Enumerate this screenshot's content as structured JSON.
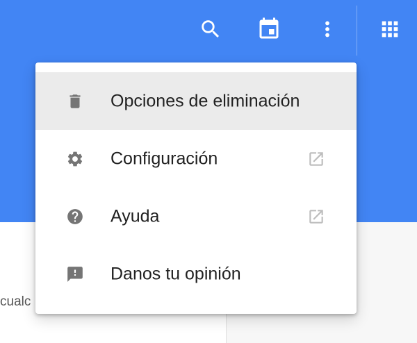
{
  "appbar": {
    "color": "#4285f4",
    "icons": {
      "search": "search-icon",
      "calendar": "calendar-icon",
      "more": "more-vert-icon",
      "apps": "apps-grid-icon"
    }
  },
  "background_text": "cualc",
  "menu": {
    "items": [
      {
        "label": "Opciones de eliminación",
        "icon": "trash-icon",
        "external": false,
        "highlighted": true
      },
      {
        "label": "Configuración",
        "icon": "gear-icon",
        "external": true,
        "highlighted": false
      },
      {
        "label": "Ayuda",
        "icon": "help-icon",
        "external": true,
        "highlighted": false
      },
      {
        "label": "Danos tu opinión",
        "icon": "feedback-icon",
        "external": false,
        "highlighted": false
      }
    ]
  }
}
